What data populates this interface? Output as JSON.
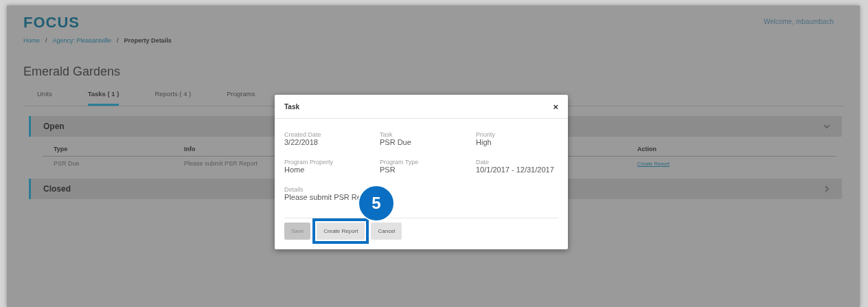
{
  "header": {
    "logo": "FOCUS",
    "welcome": "Welcome, mbaumbach"
  },
  "breadcrumbs": [
    {
      "label": "Home",
      "link": true
    },
    {
      "label": "Agency: Pleasantville",
      "link": true
    },
    {
      "label": "Property Details",
      "link": false
    }
  ],
  "breadcrumb_separator": "/",
  "title": "Emerald Gardens",
  "tabs": [
    {
      "label": "Units",
      "selected": false
    },
    {
      "label": "Tasks ( 1 )",
      "selected": true
    },
    {
      "label": "Reports ( 4 )",
      "selected": false
    },
    {
      "label": "Programs",
      "selected": false
    }
  ],
  "sections": [
    {
      "title": "Open",
      "expanded": true,
      "columns": [
        "Type",
        "Info",
        "Action"
      ],
      "rows": [
        [
          "PSR Due",
          "Please submit PSR Report",
          "Create Report"
        ]
      ]
    },
    {
      "title": "Closed",
      "expanded": false
    }
  ],
  "dialog": {
    "title": "Task",
    "close": "×",
    "fields": [
      {
        "label": "Created Date",
        "value": "3/22/2018"
      },
      {
        "label": "Task",
        "value": "PSR Due"
      },
      {
        "label": "Priority",
        "value": "High"
      },
      {
        "label": "Program Property",
        "value": "Home"
      },
      {
        "label": "Program Type",
        "value": "PSR"
      },
      {
        "label": "Date",
        "value": "10/1/2017 - 12/31/2017"
      },
      {
        "label": "Details",
        "value": "Please submit PSR Re"
      }
    ],
    "buttons": [
      {
        "label": "Save",
        "disabled": true,
        "highlighted": false
      },
      {
        "label": "Create Report",
        "disabled": false,
        "highlighted": true
      },
      {
        "label": "Cancel",
        "disabled": false,
        "highlighted": false
      }
    ],
    "callout": "5"
  }
}
